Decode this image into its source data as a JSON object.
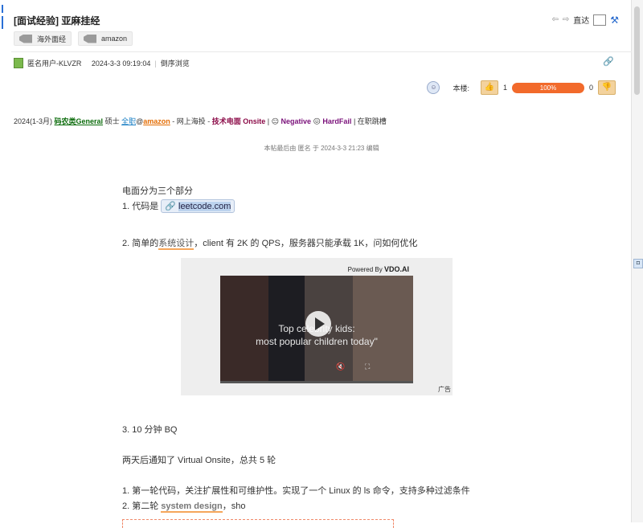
{
  "thread": {
    "title": "[面试经验] 亚麻挂经",
    "tags": [
      {
        "label": "海外面经",
        "icon": "tag-icon"
      },
      {
        "label": "amazon",
        "icon": "tag-icon"
      }
    ],
    "nav": {
      "direct_label": "直达"
    }
  },
  "post": {
    "author": "匿名用户-KLVZR",
    "timestamp": "2024-3-3 09:19:04",
    "reverse_view": "倒序浏览",
    "floor_label": "本楼:",
    "upvotes": "1",
    "vote_percent": "100%",
    "downvotes": "0",
    "tagline": {
      "prefix": "2024(1-3月) ",
      "t1": "码农类General",
      "t2": " 硕士 ",
      "t3": "全职",
      "t4": "@",
      "t5": "amazon",
      "t6": " - 网上海投 - ",
      "t7": "技术电面 Onsite",
      "t8": " | 😑 ",
      "t9": "Negative",
      "t10": " 😖 ",
      "t11": "HardFail",
      "t12": " | 在职跳槽"
    },
    "edit_note": "本帖最后由 匿名 于 2024-3-3 21:23 编辑",
    "body": {
      "p1": "电面分为三个部分",
      "p2_prefix": "1. 代码是 ",
      "p2_link": "leetcode.com",
      "p3_prefix": "2. 简单的",
      "p3_hl": "系统设计",
      "p3_suffix": "，client 有 2K 的 QPS，服务器只能承载 1K，问如何优化",
      "p4": "3. 10 分钟 BQ",
      "p5": "两天后通知了 Virtual Onsite，总共 5 轮",
      "p6": "1. 第一轮代码，关注扩展性和可维护性。实现了一个 Linux 的 ls 命令，支持多种过滤条件",
      "p7_prefix": "2. 第二轮 ",
      "p7_hl": "system design",
      "p7_suffix": "，sho"
    }
  },
  "video_ad": {
    "powered_prefix": "Powered By ",
    "powered_brand": "VDO.AI",
    "caption_line1": "Top celebrity kids:",
    "caption_line2": "most popular children today\"",
    "ad_label": "广告"
  },
  "colors": {
    "vote_bar": "#f26a2b",
    "link_blue": "#1a7fc4",
    "highlight": "#f5a65b"
  }
}
